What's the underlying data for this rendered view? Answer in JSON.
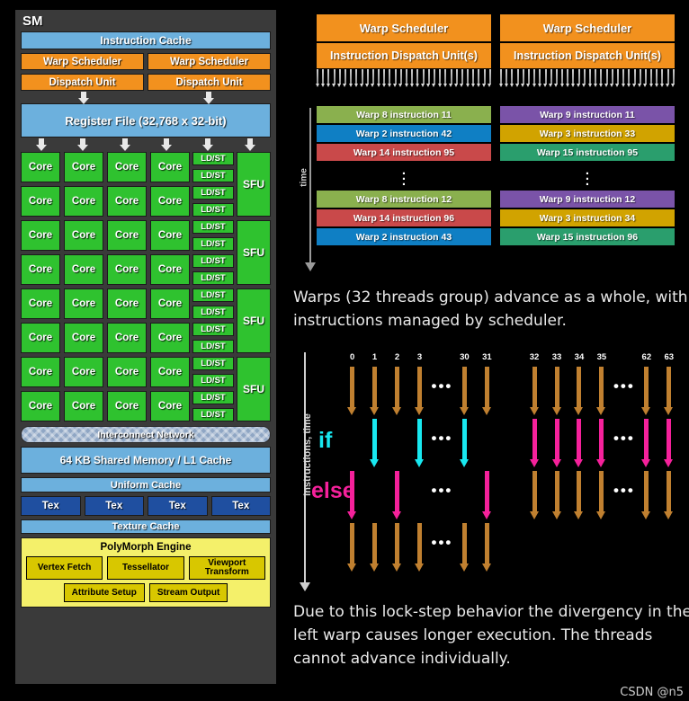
{
  "sm": {
    "title": "SM",
    "instruction_cache": "Instruction Cache",
    "warp_schedulers": [
      "Warp Scheduler",
      "Warp Scheduler"
    ],
    "dispatch_units": [
      "Dispatch Unit",
      "Dispatch Unit"
    ],
    "register_file": "Register File (32,768 x 32-bit)",
    "core_label": "Core",
    "ldst_label": "LD/ST",
    "sfu_label": "SFU",
    "core_rows": 8,
    "core_cols": 4,
    "ldst_count": 16,
    "sfu_count": 4,
    "interconnect": "Interconnect Network",
    "shared_memory": "64 KB Shared Memory / L1 Cache",
    "uniform_cache": "Uniform Cache",
    "tex_units": [
      "Tex",
      "Tex",
      "Tex",
      "Tex"
    ],
    "texture_cache": "Texture Cache",
    "polymorph": {
      "title": "PolyMorph Engine",
      "row1": [
        "Vertex Fetch",
        "Tessellator",
        "Viewport\nTransform"
      ],
      "row2": [
        "Attribute Setup",
        "Stream Output"
      ]
    },
    "colors": {
      "blue": "#6cb0dd",
      "orange": "#f2911e",
      "green": "#2fc22f",
      "dark_blue": "#1f4fa0",
      "yellow": "#f4f06a",
      "golden": "#d8c700",
      "panel": "#3a3a3a"
    }
  },
  "scheduler": {
    "columns": [
      {
        "warp_scheduler": "Warp Scheduler",
        "dispatch_unit": "Instruction Dispatch Unit(s)"
      },
      {
        "warp_scheduler": "Warp Scheduler",
        "dispatch_unit": "Instruction Dispatch Unit(s)"
      }
    ],
    "tick_count": 32,
    "time_axis_label": "time",
    "rows_top": [
      {
        "left": {
          "text": "Warp 8 instruction 11",
          "color": "#8ab04e"
        },
        "right": {
          "text": "Warp 9 instruction 11",
          "color": "#7a53a8"
        }
      },
      {
        "left": {
          "text": "Warp 2 instruction 42",
          "color": "#0f7fc4"
        },
        "right": {
          "text": "Warp 3 instruction 33",
          "color": "#d1a300"
        }
      },
      {
        "left": {
          "text": "Warp 14 instruction 95",
          "color": "#c9494a"
        },
        "right": {
          "text": "Warp 15 instruction 95",
          "color": "#2a9e6d"
        }
      }
    ],
    "gap_marker": "vertical-ellipsis",
    "rows_bottom": [
      {
        "left": {
          "text": "Warp 8 instruction 12",
          "color": "#8ab04e"
        },
        "right": {
          "text": "Warp 9 instruction 12",
          "color": "#7a53a8"
        }
      },
      {
        "left": {
          "text": "Warp 14 instruction 96",
          "color": "#c9494a"
        },
        "right": {
          "text": "Warp 3 instruction 34",
          "color": "#d1a300"
        }
      },
      {
        "left": {
          "text": "Warp 2 instruction 43",
          "color": "#0f7fc4"
        },
        "right": {
          "text": "Warp 15 instruction 96",
          "color": "#2a9e6d"
        }
      }
    ]
  },
  "caption1": "Warps (32 threads group) advance as a whole, with instructions managed by scheduler.",
  "divergence": {
    "axis_label": "Instructions, time",
    "if_label": "if",
    "else_label": "else",
    "thread_labels": [
      "0",
      "1",
      "2",
      "3",
      "30",
      "31",
      "32",
      "33",
      "34",
      "35",
      "62",
      "63"
    ],
    "ellipsis": "•••",
    "colors": {
      "brown": "#c08030",
      "cyan": "#18e8f0",
      "magenta": "#f5219b"
    },
    "bands": [
      {
        "name": "pre-branch",
        "left_warp": "brown-all",
        "right_warp": "brown-all"
      },
      {
        "name": "if-branch",
        "left_warp": "cyan-threads-1-3-30",
        "right_warp": "magenta-all"
      },
      {
        "name": "else-branch",
        "left_warp": "magenta-threads-0-2-31",
        "right_warp": "brown-all"
      },
      {
        "name": "post-branch",
        "left_warp": "brown-all",
        "right_warp": "none"
      }
    ]
  },
  "caption2": "Due to this lock-step behavior the divergency in the left warp causes longer execution. The threads cannot advance individually.",
  "watermark": "CSDN @n5"
}
